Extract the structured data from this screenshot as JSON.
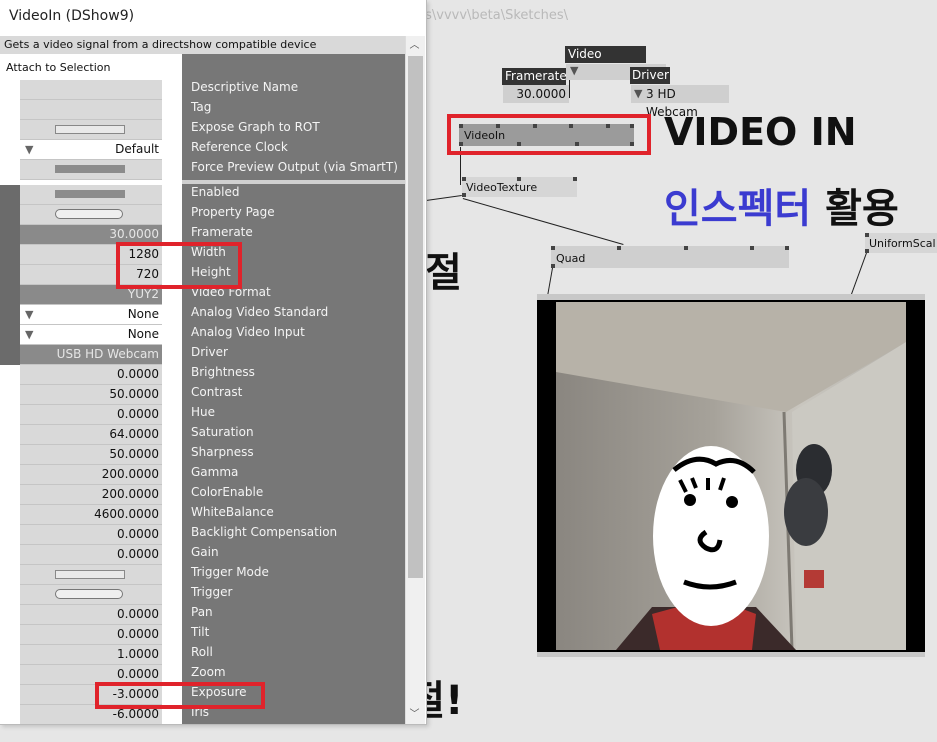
{
  "window": {
    "title": "VideoIn (DShow9)"
  },
  "path_text": "ts\\vvvv\\beta\\Sketches\\",
  "inspector": {
    "description": "Gets a video signal from a directshow compatible device",
    "attach_label": "Attach to Selection",
    "labels": [
      "Descriptive Name",
      "Tag",
      "Expose Graph to ROT",
      "Reference Clock",
      "Force Preview Output (via SmartT)",
      "Enabled",
      "Property Page",
      "Framerate",
      "Width",
      "Height",
      "Video Format",
      "Analog Video Standard",
      "Analog Video Input",
      "Driver",
      "Brightness",
      "Contrast",
      "Hue",
      "Saturation",
      "Sharpness",
      "Gamma",
      "ColorEnable",
      "WhiteBalance",
      "Backlight Compensation",
      "Gain",
      "Trigger Mode",
      "Trigger",
      "Pan",
      "Tilt",
      "Roll",
      "Zoom",
      "Exposure",
      "Iris"
    ],
    "values": {
      "reference_clock": "Default",
      "framerate": "30.0000",
      "width": "1280",
      "height": "720",
      "video_format": "YUY2",
      "analog_video_standard": "None",
      "analog_video_input": "None",
      "driver": "USB HD Webcam",
      "brightness": "0.0000",
      "contrast": "50.0000",
      "hue": "0.0000",
      "saturation": "64.0000",
      "sharpness": "50.0000",
      "gamma": "200.0000",
      "colorenable": "200.0000",
      "whitebalance": "4600.0000",
      "backlight_compensation": "0.0000",
      "gain": "0.0000",
      "pan": "0.0000",
      "tilt": "0.0000",
      "roll": "1.0000",
      "zoom": "0.0000",
      "exposure": "-3.0000",
      "iris": "-6.0000"
    }
  },
  "nodes": {
    "video_format_label": "Video Format",
    "framerate_label": "Framerate",
    "framerate_value": "30.0000",
    "driver_label": "Driver",
    "driver_value": "3 HD Webcam",
    "videoin": "VideoIn",
    "videotexture": "VideoTexture",
    "quad": "Quad",
    "uniformscale": "UniformScal"
  },
  "annotations": {
    "video_in": "VIDEO IN",
    "inspector_use_part1": "인스펙터",
    "inspector_use_part2": "활용",
    "resolution": "해상도 조절",
    "brightness": "밝기 조절!"
  },
  "colors": {
    "highlight": "#e0232b",
    "accent_blue": "#3b3bd0"
  }
}
